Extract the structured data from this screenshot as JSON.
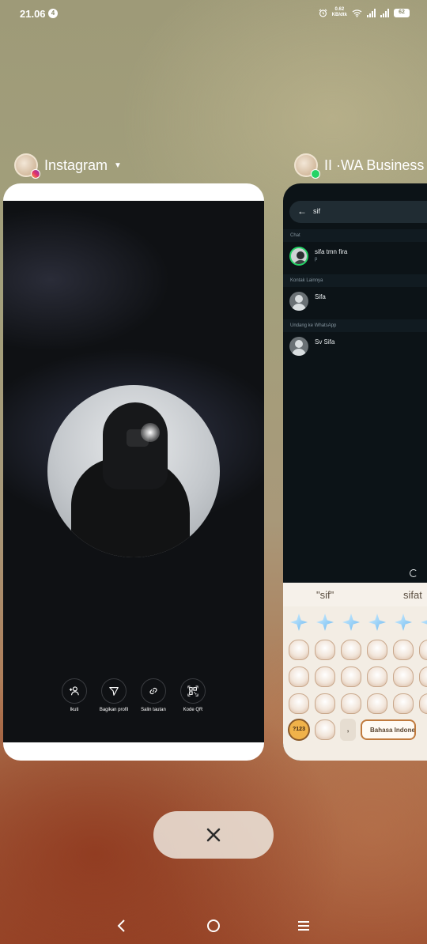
{
  "status_bar": {
    "time": "21.06",
    "notification_count": "4",
    "net_speed_value": "0.62",
    "net_speed_unit": "KB/dtk",
    "battery": "62"
  },
  "recents": {
    "apps": [
      {
        "label": "Instagram",
        "icon": "instagram-profile-icon"
      },
      {
        "label": "II ·WA Business",
        "icon": "whatsapp-business-profile-icon"
      }
    ]
  },
  "instagram_card": {
    "actions": [
      {
        "label": "Ikuti",
        "icon": "add-person-icon"
      },
      {
        "label": "Bagikan profil",
        "icon": "send-icon"
      },
      {
        "label": "Salin tautan",
        "icon": "link-icon"
      },
      {
        "label": "Kode QR",
        "icon": "qr-code-icon"
      }
    ]
  },
  "wa_card": {
    "search_query": "sif",
    "sections": {
      "chat": "Chat",
      "contacts": "Kontak Lainnya",
      "invite": "Undang ke WhatsApp"
    },
    "results": [
      {
        "name": "sifa tmn fira",
        "subtitle": "p"
      },
      {
        "name": "Sifa",
        "subtitle": ""
      },
      {
        "name": "Sv Sifa",
        "subtitle": ""
      }
    ],
    "keyboard": {
      "suggestions": [
        "\"sif\"",
        "sifat"
      ],
      "key_123": "?123",
      "key_comma": ",",
      "space_label": "Bahasa Indonesia"
    }
  },
  "colors": {
    "wa_accent": "#25d366",
    "close_button_bg": "#ebe1d7"
  }
}
